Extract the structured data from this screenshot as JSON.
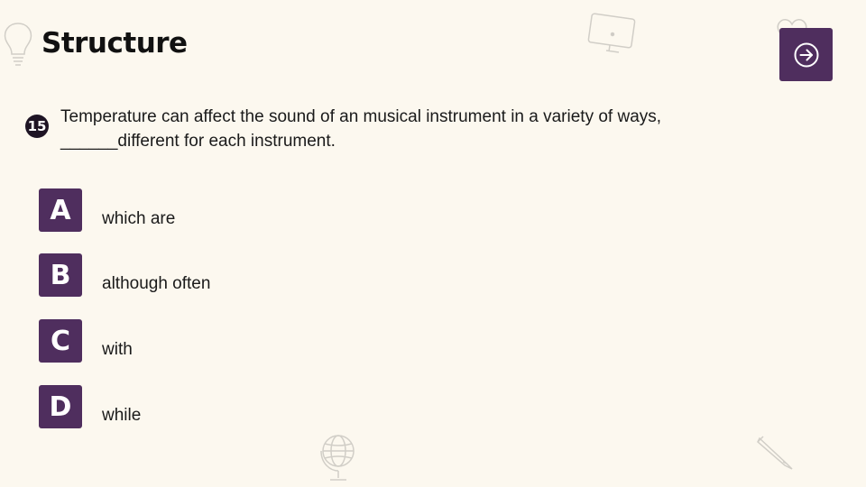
{
  "slide": {
    "title": "Structure"
  },
  "question": {
    "number": "15",
    "text_line1": "Temperature can affect the sound of an musical instrument in a variety of ways,",
    "text_line2": "______different for each instrument."
  },
  "options": [
    {
      "letter": "A",
      "text": "which are"
    },
    {
      "letter": "B",
      "text": "although often"
    },
    {
      "letter": "C",
      "text": "with"
    },
    {
      "letter": "D",
      "text": "while"
    }
  ],
  "icons": {
    "next": "arrow-right-circle-icon",
    "decorations": [
      "lightbulb-icon",
      "monitor-icon",
      "heart-icon",
      "globe-icon",
      "pencil-icon"
    ]
  },
  "colors": {
    "background": "#fcf8ef",
    "accent": "#4f2e5e",
    "badge": "#1e1424"
  }
}
